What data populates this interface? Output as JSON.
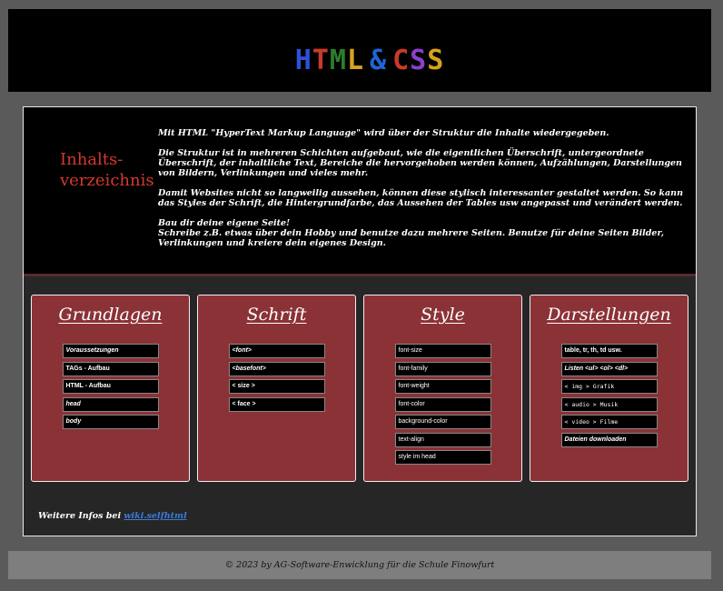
{
  "header": {
    "logo_text": "HTML & CSS",
    "logo_glyphs": [
      "H",
      "T",
      "M",
      "L",
      " ",
      "&",
      " ",
      "C",
      "S",
      "S"
    ],
    "logo_colors": [
      "#2f50d8",
      "#c93a2a",
      "#2c7e2c",
      "#d6a21e",
      "#000000",
      "#1e66d6",
      "#000000",
      "#c93a2a",
      "#8a3fcf",
      "#d6a21e"
    ]
  },
  "intro": {
    "toc_title": "Inhalts-verzeichnis",
    "paragraphs": [
      "Mit HTML \"HyperText Markup Language\" wird über der Struktur die Inhalte wiedergegeben.",
      "Die Struktur ist in mehreren Schichten aufgebaut, wie die eigentlichen Überschrift, untergeordnete Überschrift, der inhaltliche Text, Bereiche die hervorgehoben werden können, Aufzählungen, Darstellungen von Bildern, Verlinkungen und vieles mehr.",
      "Damit Websites nicht so langweilig aussehen, können diese stylisch interessanter gestaltet werden. So kann das Styles der Schrift, die Hintergrundfarbe, das Aussehen der Tables usw angepasst und verändert werden.",
      "Bau dir deine eigene Seite!",
      "Schreibe z.B. etwas über dein Hobby und benutze dazu mehrere Seiten. Benutze für deine Seiten Bilder, Verlinkungen und kreiere dein eigenes Design."
    ]
  },
  "cards": [
    {
      "title": "Grundlagen",
      "items": [
        "Voraussetzungen",
        "TAGs - Aufbau",
        "HTML - Aufbau",
        "head",
        "body"
      ]
    },
    {
      "title": "Schrift",
      "items": [
        "<font>",
        "<basefont>",
        "< size >",
        "< face >"
      ]
    },
    {
      "title": "Style",
      "items": [
        "font-size",
        "font-family",
        "font-weight",
        "font-color",
        "background-color",
        "text-align",
        "style im head"
      ]
    },
    {
      "title": "Darstellungen",
      "items": [
        "table, tr, th, td usw.",
        "Listen <ul> <ol> <dl>",
        "< img > Grafik",
        "< audio > Musik",
        "< video > Filme",
        "Dateien downloaden"
      ]
    }
  ],
  "more_info": {
    "label": "Weitere Infos bei",
    "link_text": "wiki.selfhtml"
  },
  "footer": {
    "text": "© 2023 by AG-Software-Enwicklung für die Schule Finowfurt"
  }
}
